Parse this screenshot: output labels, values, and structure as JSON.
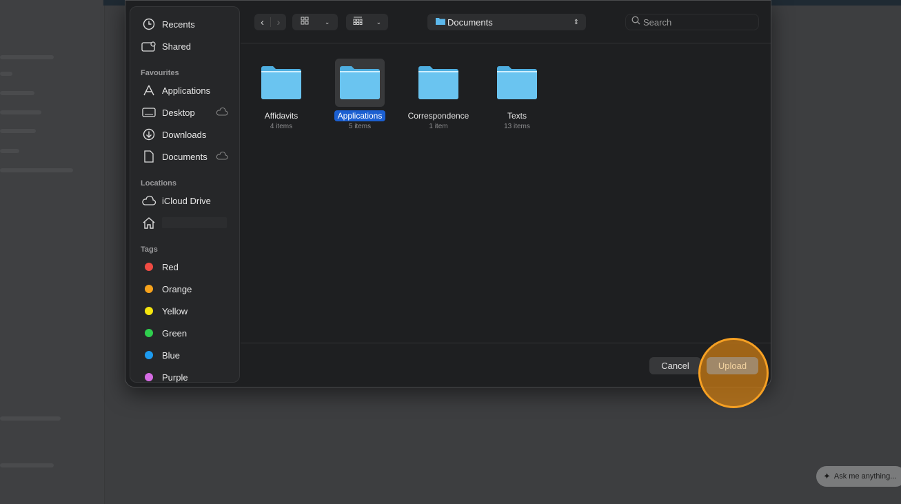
{
  "sidebar": {
    "recents": "Recents",
    "shared": "Shared",
    "favourites_header": "Favourites",
    "favourites": [
      "Applications",
      "Desktop",
      "Downloads",
      "Documents"
    ],
    "locations_header": "Locations",
    "icloud": "iCloud Drive",
    "tags_header": "Tags",
    "tags": [
      {
        "label": "Red",
        "color": "#f04b43"
      },
      {
        "label": "Orange",
        "color": "#f7a31c"
      },
      {
        "label": "Yellow",
        "color": "#f5e50e"
      },
      {
        "label": "Green",
        "color": "#2fcf4e"
      },
      {
        "label": "Blue",
        "color": "#1d9bf0"
      },
      {
        "label": "Purple",
        "color": "#d56be3"
      }
    ]
  },
  "toolbar": {
    "location": "Documents",
    "search_placeholder": "Search"
  },
  "folders": [
    {
      "name": "Affidavits",
      "count": "4 items"
    },
    {
      "name": "Applications",
      "count": "5 items",
      "selected": true
    },
    {
      "name": "Correspondence",
      "count": "1 item"
    },
    {
      "name": "Texts",
      "count": "13 items"
    }
  ],
  "footer": {
    "cancel": "Cancel",
    "upload": "Upload"
  },
  "assistant": {
    "label": "Ask me anything..."
  }
}
